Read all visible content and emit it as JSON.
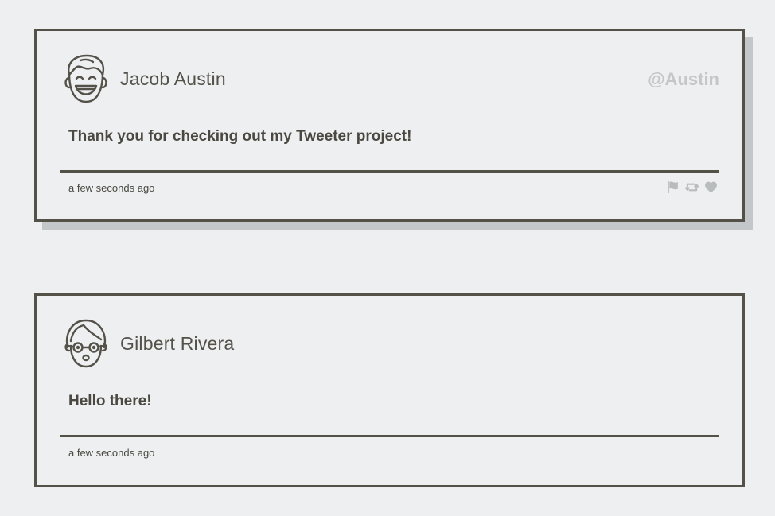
{
  "tweets": [
    {
      "name": "Jacob Austin",
      "handle": "@Austin",
      "text": "Thank you for checking out my Tweeter project!",
      "timestamp": "a few seconds ago",
      "avatar_icon": "smiling-face-avatar-icon",
      "actions": [
        "flag-icon",
        "retweet-icon",
        "heart-icon"
      ]
    },
    {
      "name": "Gilbert Rivera",
      "text": "Hello there!",
      "timestamp": "a few seconds ago",
      "avatar_icon": "glasses-face-avatar-icon"
    }
  ],
  "colors": {
    "background": "#edeff1",
    "border": "#545149",
    "shadow": "#c4c7ca",
    "handle": "#c4c6c8",
    "icons": "#b9bcbf"
  }
}
